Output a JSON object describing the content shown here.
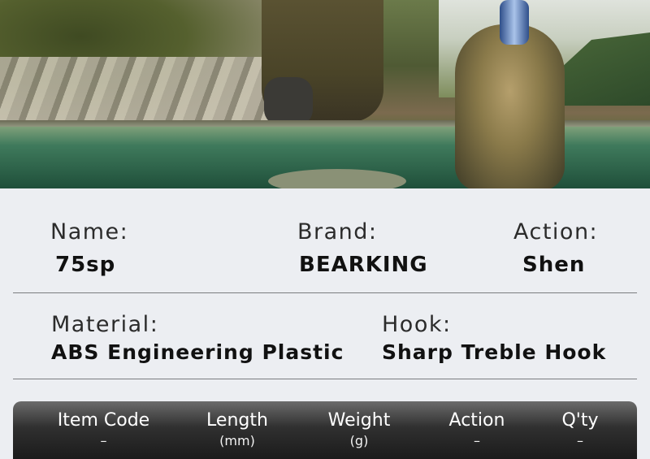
{
  "details": {
    "name_label": "Name:",
    "name_value": "75sp",
    "brand_label": "Brand:",
    "brand_value": "BEARKING",
    "action_label": "Action:",
    "action_value": "Shen",
    "material_label": "Material:",
    "material_value": "ABS Engineering Plastic",
    "hook_label": "Hook:",
    "hook_value": "Sharp Treble Hook"
  },
  "spec_table": {
    "columns": [
      {
        "header": "Item Code",
        "unit": "–"
      },
      {
        "header": "Length",
        "unit": "(mm)"
      },
      {
        "header": "Weight",
        "unit": "(g)"
      },
      {
        "header": "Action",
        "unit": "–"
      },
      {
        "header": "Q'ty",
        "unit": "–"
      }
    ]
  }
}
